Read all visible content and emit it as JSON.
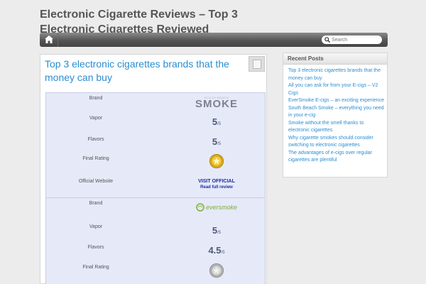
{
  "site": {
    "title": "Electronic Cigarette Reviews – Top 3 Electronic Cigarettes Reviewed"
  },
  "nav": {
    "home_icon": "home-icon",
    "search_icon": "magnifier-icon",
    "search_placeholder": "Search"
  },
  "post": {
    "title": "Top 3 electronic cigarettes brands that the money can buy"
  },
  "reviews": [
    {
      "brand_label": "Brand",
      "brand_logo_top": "SOUTH BEACH",
      "brand_logo": "SMOKE",
      "vapor_label": "Vapor",
      "vapor_score": "5",
      "vapor_out_of": "/5",
      "flavors_label": "Flavors",
      "flavors_score": "5",
      "flavors_out_of": "/5",
      "final_label": "Final Rating",
      "medal": "gold-medal",
      "website_label": "Official Website",
      "visit_label": "VISIT OFFICIAL",
      "read_label": "Read full review"
    },
    {
      "brand_label": "Brand",
      "brand_logo": "eversmoke",
      "vapor_label": "Vapor",
      "vapor_score": "5",
      "vapor_out_of": "/5",
      "flavors_label": "Flavors",
      "flavors_score": "4.5",
      "flavors_out_of": "/5",
      "final_label": "Final Rating",
      "medal": "silver-medal"
    }
  ],
  "sidebar": {
    "heading": "Recent Posts",
    "items": [
      "Top 3 electronic cigarettes brands that the money can buy",
      "All you can ask for from your E-cigs – V2 Cigs",
      "EverSmoke E-cigs – an exciting experience",
      "South Beach Smoke – everything you need in your e-cig",
      "Smoke without the smell thanks to electronic cigarettes",
      "Why cigarette smokes should consider switching to electronic cigarettes",
      "The advantages of e-cigs over regular cigarettes are plentiful"
    ]
  },
  "colors": {
    "background": "#ececec",
    "link": "#2a8dd1",
    "table_bg": "#e6e9f8",
    "nav_bar": "#555555"
  }
}
